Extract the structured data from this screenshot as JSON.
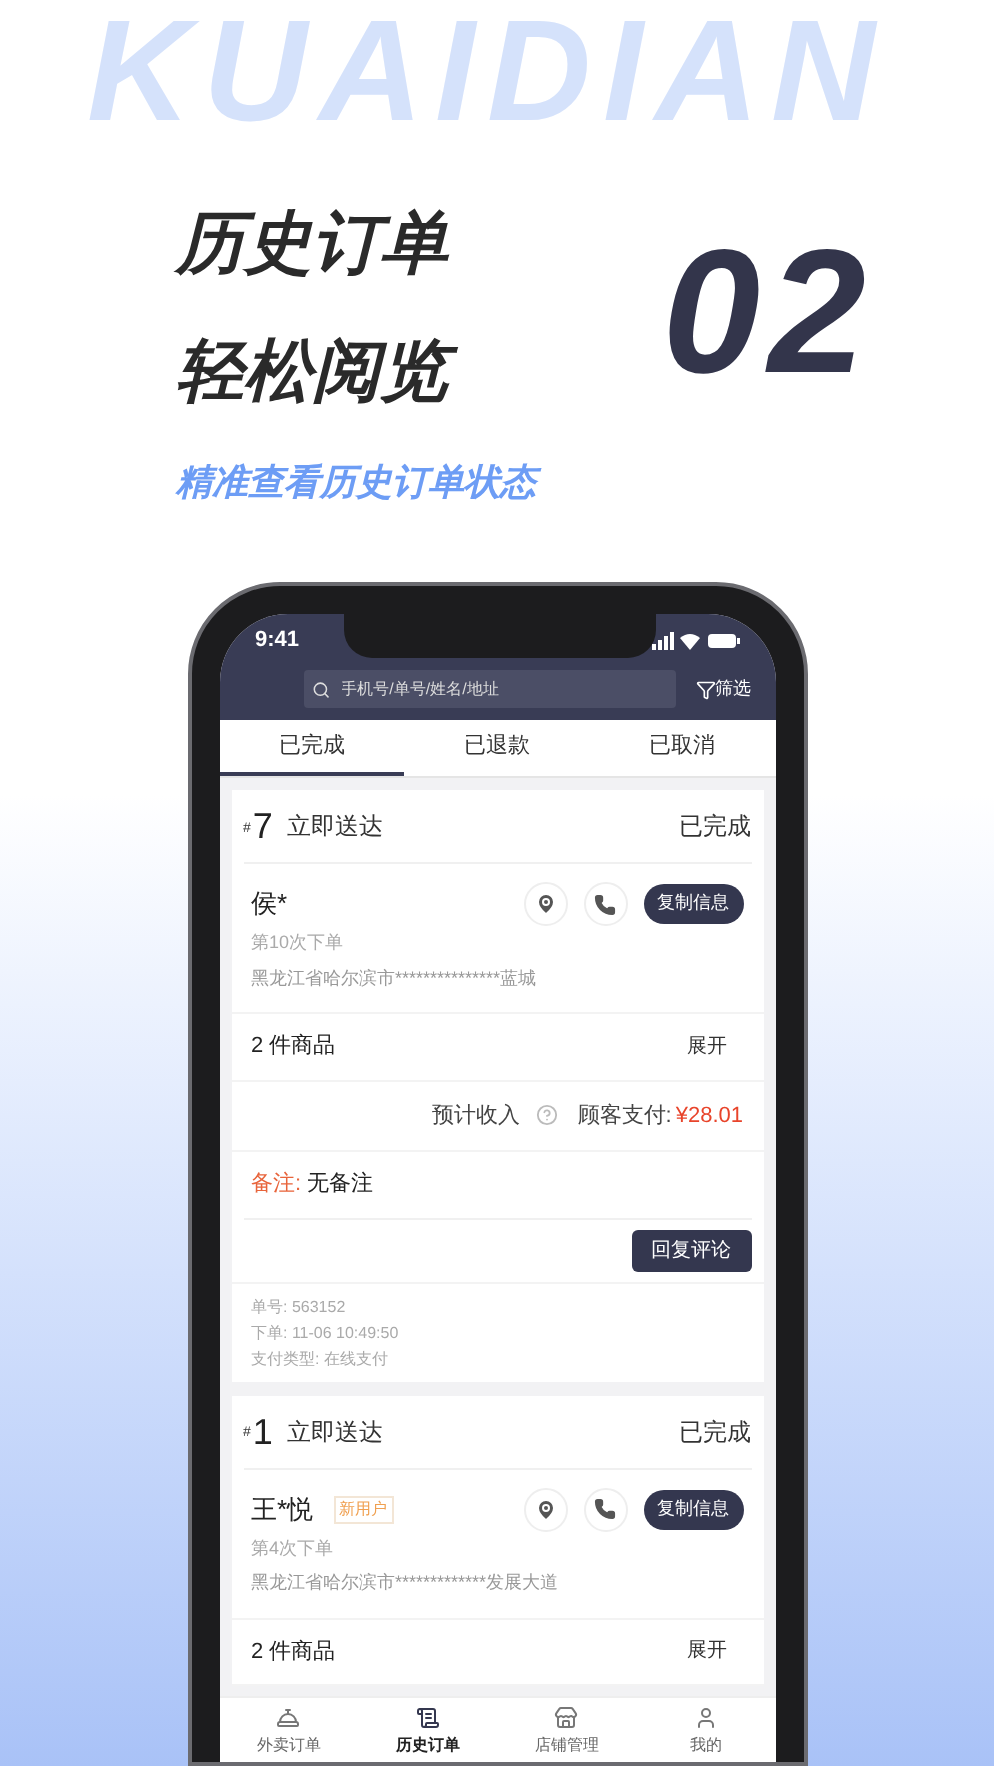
{
  "background_word": "KUAIDIAN",
  "headline": [
    "历史订单",
    "轻松阅览"
  ],
  "number": "02",
  "subtitle": "精准查看历史订单状态",
  "phone": {
    "status_time": "9:41",
    "search": {
      "placeholder": "手机号/单号/姓名/地址"
    },
    "filter_label": "筛选",
    "tabs": [
      {
        "label": "已完成",
        "selected": true
      },
      {
        "label": "已退款",
        "selected": false
      },
      {
        "label": "已取消",
        "selected": false
      }
    ],
    "orders": [
      {
        "hash": "#",
        "number": "7",
        "delivery": "立即送达",
        "status": "已完成",
        "customer": "侯*",
        "order_count": "第10次下单",
        "address": "黑龙江省哈尔滨市***************蓝城",
        "copy_label": "复制信息",
        "goods": "2 件商品",
        "expand": "展开",
        "income_label": "预计收入",
        "paid_label": "顾客支付:",
        "paid_amount": "¥28.01",
        "remark_label": "备注:",
        "remark": "无备注",
        "reply_button": "回复评论",
        "details": [
          "单号: 563152",
          "下单: 11-06 10:49:50",
          "支付类型: 在线支付"
        ]
      },
      {
        "hash": "#",
        "number": "1",
        "delivery": "立即送达",
        "status": "已完成",
        "customer": "王*悦",
        "badge": "新用户",
        "order_count": "第4次下单",
        "address": "黑龙江省哈尔滨市*************发展大道",
        "copy_label": "复制信息",
        "goods": "2 件商品",
        "expand": "展开"
      }
    ],
    "bottom_nav": [
      {
        "label": "外卖订单",
        "selected": false
      },
      {
        "label": "历史订单",
        "selected": true
      },
      {
        "label": "店铺管理",
        "selected": false
      },
      {
        "label": "我的",
        "selected": false
      }
    ]
  }
}
